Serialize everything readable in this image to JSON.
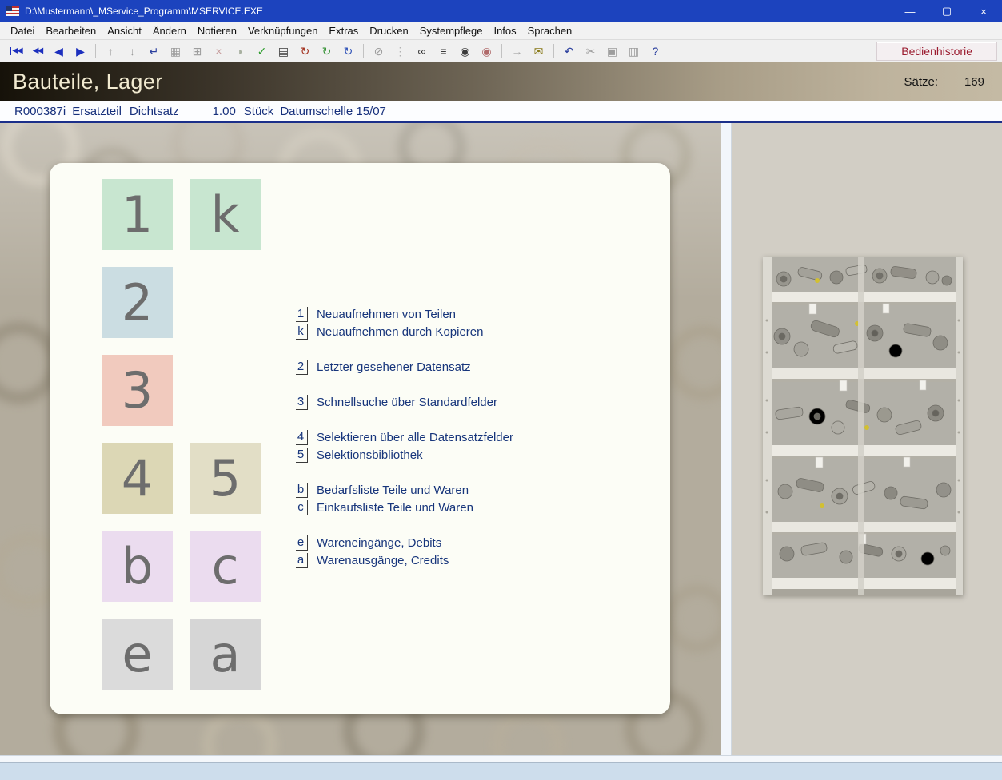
{
  "colors": {
    "titlebar_blue": "#1c43be",
    "header_dark": "#161209",
    "header_tan": "#c4baa4",
    "option_text_blue": "#17357b",
    "history_red": "#9b1c30"
  },
  "window": {
    "title": "D:\\Mustermann\\_MService_Programm\\MSERVICE.EXE",
    "minimize_glyph": "—",
    "maximize_glyph": "▢",
    "close_glyph": "×"
  },
  "menubar": {
    "items": [
      "Datei",
      "Bearbeiten",
      "Ansicht",
      "Ändern",
      "Notieren",
      "Verknüpfungen",
      "Extras",
      "Drucken",
      "Systempflege",
      "Infos",
      "Sprachen"
    ]
  },
  "toolbar": {
    "history_label": "Bedienhistorie",
    "buttons": [
      {
        "name": "first-record",
        "glyph": "◀◀",
        "color": "#1c2fbe"
      },
      {
        "name": "fast-rewind",
        "glyph": "◀◀",
        "color": "#1c2fbe"
      },
      {
        "name": "previous-record",
        "glyph": "◀",
        "color": "#1c2fbe"
      },
      {
        "name": "next-record",
        "glyph": "▶",
        "color": "#1c2fbe"
      },
      {
        "name": "move-up",
        "glyph": "↑",
        "color": "#9d9d9d"
      },
      {
        "name": "move-down",
        "glyph": "↓",
        "color": "#9d9d9d"
      },
      {
        "name": "enter-record",
        "glyph": "↵",
        "color": "#2b3f9e"
      },
      {
        "name": "save-record",
        "glyph": "▦",
        "color": "#9d9d9d"
      },
      {
        "name": "tree-view",
        "glyph": "⊞",
        "color": "#9d9d9d"
      },
      {
        "name": "delete-record",
        "glyph": "×",
        "color": "#c59a9a"
      },
      {
        "name": "discard-changes",
        "glyph": "◗",
        "color": "#a8b0a0"
      },
      {
        "name": "confirm",
        "glyph": "✓",
        "color": "#2f9e2f"
      },
      {
        "name": "record-notes",
        "glyph": "▤",
        "color": "#3a3a3a"
      },
      {
        "name": "refresh-red",
        "glyph": "↻",
        "color": "#a33220"
      },
      {
        "name": "refresh-green",
        "glyph": "↻",
        "color": "#2f8f2f"
      },
      {
        "name": "refresh-blue",
        "glyph": "↻",
        "color": "#2f52b8"
      },
      {
        "name": "unlink",
        "glyph": "⊘",
        "color": "#9d9d9d"
      },
      {
        "name": "link-list",
        "glyph": "⋮",
        "color": "#b2b2b2"
      },
      {
        "name": "search-binoculars",
        "glyph": "∞",
        "color": "#2a2a2a"
      },
      {
        "name": "list-view",
        "glyph": "≡",
        "color": "#3a3a3a"
      },
      {
        "name": "show-eye",
        "glyph": "◉",
        "color": "#3a3a3a"
      },
      {
        "name": "hide-eye",
        "glyph": "◉",
        "color": "#b06a6a"
      },
      {
        "name": "forward-arrow",
        "glyph": "→",
        "color": "#a8a8a8"
      },
      {
        "name": "mail",
        "glyph": "✉",
        "color": "#8a7a1a"
      },
      {
        "name": "undo",
        "glyph": "↶",
        "color": "#2b3f9e"
      },
      {
        "name": "cut",
        "glyph": "✂",
        "color": "#9d9d9d"
      },
      {
        "name": "copy",
        "glyph": "▣",
        "color": "#9d9d9d"
      },
      {
        "name": "paste",
        "glyph": "▥",
        "color": "#9d9d9d"
      },
      {
        "name": "help",
        "glyph": "?",
        "color": "#2b3f9e"
      }
    ]
  },
  "header": {
    "title": "Bauteile, Lager",
    "records_label": "Sätze:",
    "records_value": "169"
  },
  "record_bar": {
    "record_id": "R000387i",
    "category": "Ersatzteil",
    "part_type": "Dichtsatz",
    "quantity": "1.00",
    "unit": "Stück",
    "description": "Datumschelle 15/07"
  },
  "menu_panel": {
    "tiles": [
      {
        "key": "1",
        "bg": "#c8e6d0"
      },
      {
        "key": "k",
        "bg": "#c8e6d0"
      },
      {
        "key": "2",
        "bg": "#cbdde2"
      },
      {
        "key": "3",
        "bg": "#f1cabe"
      },
      {
        "key": "4",
        "bg": "#dcd7b5"
      },
      {
        "key": "5",
        "bg": "#e2dec6"
      },
      {
        "key": "b",
        "bg": "#ebdcef"
      },
      {
        "key": "c",
        "bg": "#ebdcef"
      },
      {
        "key": "e",
        "bg": "#dbdbdb"
      },
      {
        "key": "a",
        "bg": "#d6d6d6"
      }
    ],
    "options": [
      {
        "key": "1",
        "label": "Neuaufnehmen von Teilen"
      },
      {
        "key": "k",
        "label": "Neuaufnehmen durch Kopieren"
      },
      {
        "key": "2",
        "label": "Letzter gesehener Datensatz"
      },
      {
        "key": "3",
        "label": "Schnellsuche über Standardfelder"
      },
      {
        "key": "4",
        "label": "Selektieren über alle Datensatzfelder"
      },
      {
        "key": "5",
        "label": "Selektionsbibliothek"
      },
      {
        "key": "b",
        "label": "Bedarfsliste Teile und Waren"
      },
      {
        "key": "c",
        "label": "Einkaufsliste Teile und Waren"
      },
      {
        "key": "e",
        "label": "Wareneingänge, Debits"
      },
      {
        "key": "a",
        "label": "Warenausgänge, Credits"
      }
    ]
  }
}
